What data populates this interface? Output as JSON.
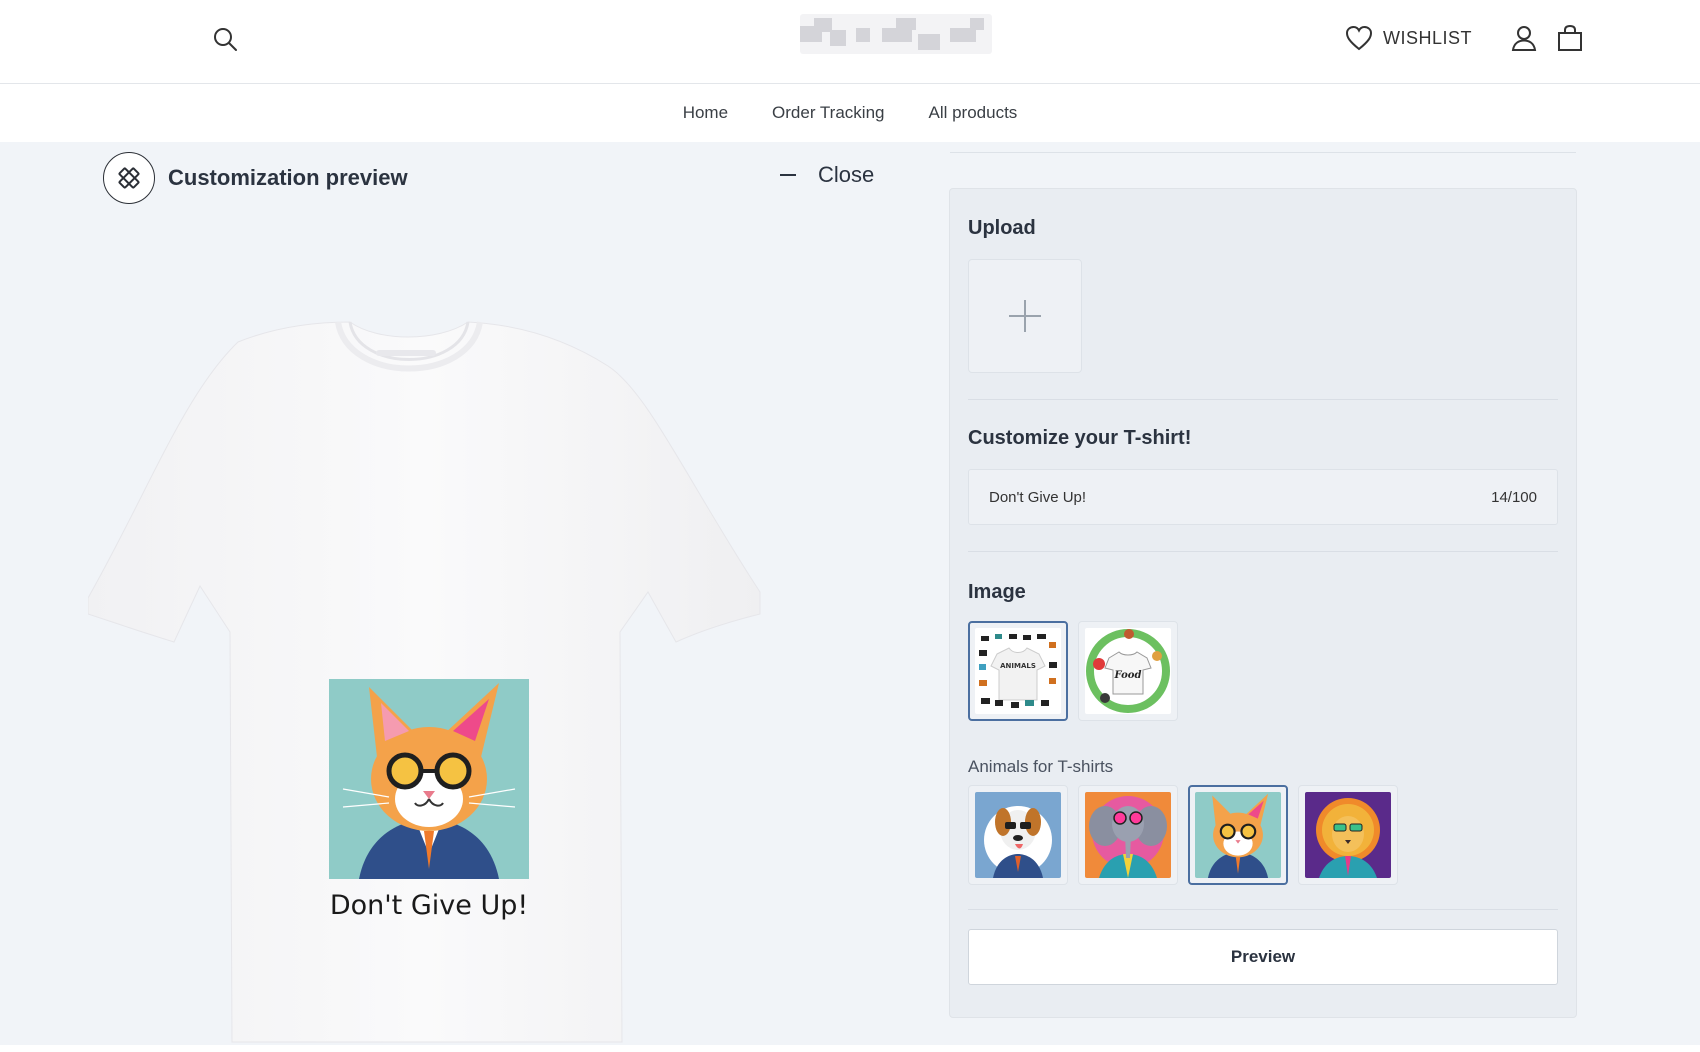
{
  "header": {
    "wishlist_label": "WISHLIST"
  },
  "nav": {
    "items": [
      {
        "label": "Home"
      },
      {
        "label": "Order Tracking"
      },
      {
        "label": "All products"
      }
    ]
  },
  "preview": {
    "title": "Customization preview",
    "close_label": "Close",
    "shirt_text": "Don't Give Up!"
  },
  "panel": {
    "upload_title": "Upload",
    "customize_title": "Customize your T-shirt!",
    "text_value": "Don't Give Up!",
    "char_count": "14/100",
    "image_title": "Image",
    "categories": [
      {
        "name": "animals-category",
        "thumb_text": "ANIMALS",
        "selected": true
      },
      {
        "name": "food-category",
        "thumb_text": "Food",
        "selected": false
      }
    ],
    "group_label": "Animals for T-shirts",
    "designs": [
      {
        "name": "dog",
        "selected": false
      },
      {
        "name": "elephant",
        "selected": false
      },
      {
        "name": "cat",
        "selected": true
      },
      {
        "name": "lion",
        "selected": false
      }
    ],
    "preview_button": "Preview"
  },
  "colors": {
    "accent": "#4b6fa0",
    "page_bg": "#f1f4f8",
    "panel_bg": "#e9edf2"
  },
  "icons": [
    "search-icon",
    "heart-icon",
    "user-icon",
    "bag-icon",
    "customize-icon",
    "plus-icon"
  ]
}
